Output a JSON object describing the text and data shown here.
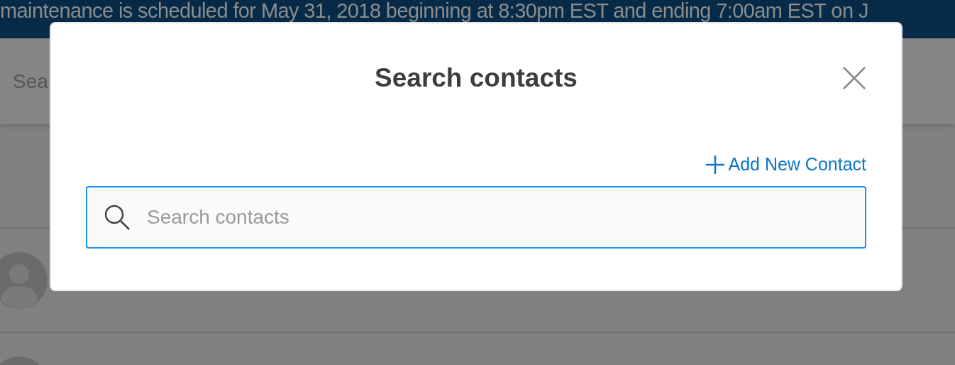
{
  "banner": {
    "text": "maintenance is scheduled for May 31, 2018 beginning at 8:30pm EST and ending 7:00am EST on J"
  },
  "page": {
    "search_label": "Sea"
  },
  "dialog": {
    "title": "Search contacts",
    "add_link": "Add New Contact",
    "search": {
      "placeholder": "Search contacts",
      "focused": true
    }
  }
}
